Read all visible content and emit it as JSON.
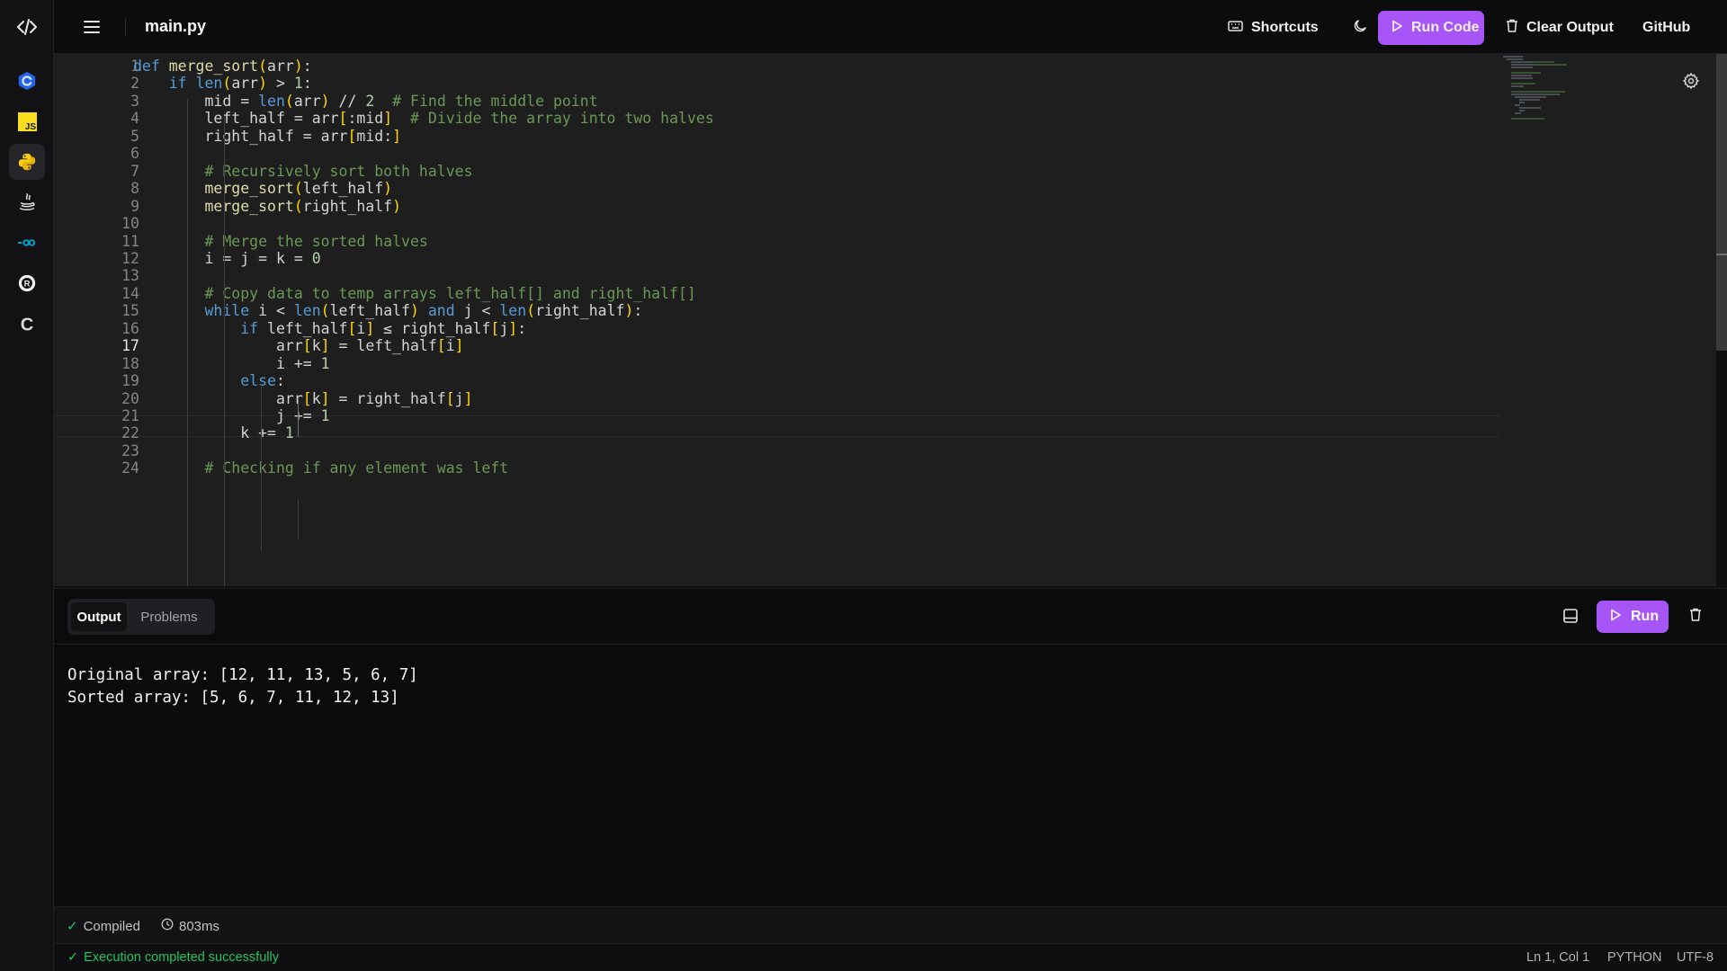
{
  "header": {
    "file_name": "main.py",
    "shortcuts_label": "Shortcuts",
    "run_code_label": "Run Code",
    "clear_output_label": "Clear Output",
    "github_label": "GitHub"
  },
  "sidebar": {
    "languages": [
      {
        "name": "C++",
        "icon": "cpp-icon"
      },
      {
        "name": "JavaScript",
        "icon": "javascript-icon",
        "badge": "JS"
      },
      {
        "name": "Python",
        "icon": "python-icon",
        "active": true
      },
      {
        "name": "Java",
        "icon": "java-icon"
      },
      {
        "name": "Go",
        "icon": "go-icon"
      },
      {
        "name": "Rust",
        "icon": "rust-icon"
      },
      {
        "name": "C",
        "icon": "c-icon",
        "badge": "C"
      }
    ]
  },
  "editor": {
    "current_line": 17,
    "line_numbers": [
      "1",
      "2",
      "3",
      "4",
      "5",
      "6",
      "7",
      "8",
      "9",
      "10",
      "11",
      "12",
      "13",
      "14",
      "15",
      "16",
      "17",
      "18",
      "19",
      "20",
      "21",
      "22",
      "23",
      "24"
    ],
    "lines": [
      "def merge_sort(arr):",
      "    if len(arr) > 1:",
      "        mid = len(arr) // 2  # Find the middle point",
      "        left_half = arr[:mid]  # Divide the array into two halves",
      "        right_half = arr[mid:]",
      "",
      "        # Recursively sort both halves",
      "        merge_sort(left_half)",
      "        merge_sort(right_half)",
      "",
      "        # Merge the sorted halves",
      "        i = j = k = 0",
      "",
      "        # Copy data to temp arrays left_half[] and right_half[]",
      "        while i < len(left_half) and j < len(right_half):",
      "            if left_half[i] ≤ right_half[j]:",
      "                arr[k] = left_half[i]",
      "                i += 1",
      "            else:",
      "                arr[k] = right_half[j]",
      "                j += 1",
      "            k += 1",
      "",
      "        # Checking if any element was left"
    ]
  },
  "output_panel": {
    "tabs": [
      "Output",
      "Problems"
    ],
    "active_tab": "Output",
    "run_label": "Run",
    "lines": [
      "Original array: [12, 11, 13, 5, 6, 7]",
      "Sorted array: [5, 6, 7, 11, 12, 13]"
    ]
  },
  "status": {
    "compiled": "Compiled",
    "duration": "803ms",
    "message": "Execution completed successfully",
    "cursor": "Ln 1, Col 1",
    "language": "PYTHON",
    "encoding": "UTF-8"
  },
  "colors": {
    "accent": "#a855f7",
    "success": "#22c55e",
    "keyword": "#569cd6",
    "function": "#dcdcaa",
    "comment": "#6a9955",
    "number": "#b5cea8",
    "bracket": "#ffd700"
  }
}
